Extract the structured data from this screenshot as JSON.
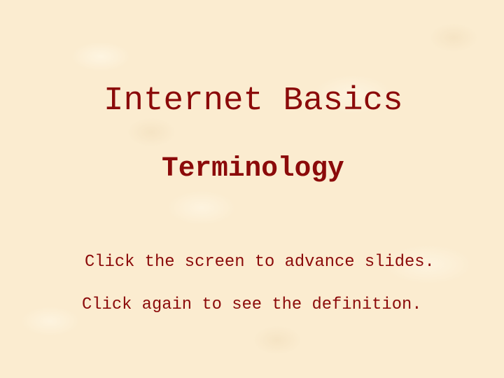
{
  "slide": {
    "title": "Internet Basics",
    "subtitle": "Terminology",
    "instructions": [
      "Click the screen to advance slides.",
      "Click again to see the definition."
    ],
    "colors": {
      "text": "#8b0a0a",
      "background": "#fbecd0"
    }
  }
}
